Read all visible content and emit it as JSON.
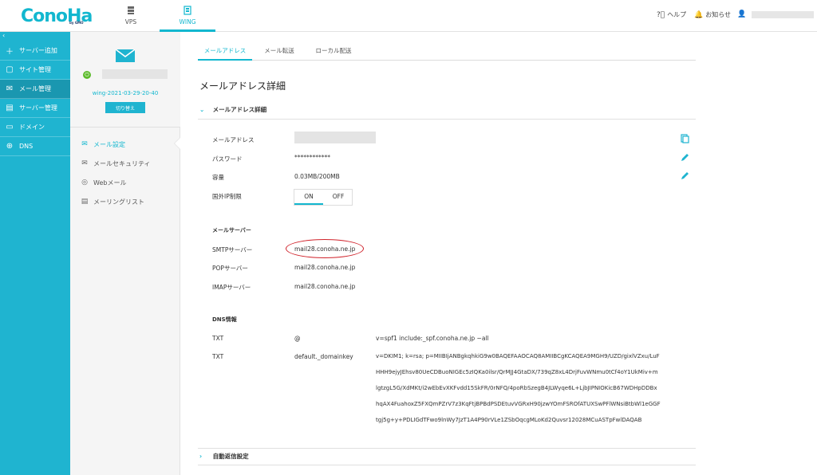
{
  "header": {
    "logo": "ConoHa",
    "logo_sub": "by GMO",
    "nav": [
      {
        "label": "VPS"
      },
      {
        "label": "WING"
      }
    ],
    "help": "ヘルプ",
    "notice": "お知らせ"
  },
  "sidebar": {
    "collapse": "‹",
    "items": [
      {
        "label": "サーバー追加"
      },
      {
        "label": "サイト管理"
      },
      {
        "label": "メール管理"
      },
      {
        "label": "サーバー管理"
      },
      {
        "label": "ドメイン"
      },
      {
        "label": "DNS"
      }
    ]
  },
  "account": {
    "id": "wing-2021-03-29-20-40",
    "switch_label": "切り替え"
  },
  "subnav": [
    {
      "label": "メール設定"
    },
    {
      "label": "メールセキュリティ"
    },
    {
      "label": "Webメール"
    },
    {
      "label": "メーリングリスト"
    }
  ],
  "tabs": [
    {
      "label": "メールアドレス"
    },
    {
      "label": "メール転送"
    },
    {
      "label": "ローカル配送"
    }
  ],
  "main": {
    "title": "メールアドレス詳細",
    "section1": "メールアドレス詳細",
    "rows": {
      "address_label": "メールアドレス",
      "password_label": "パスワード",
      "password_value": "************",
      "capacity_label": "容量",
      "capacity_value": "0.03MB/200MB",
      "foreign_ip_label": "国外IP制限",
      "on": "ON",
      "off": "OFF"
    },
    "mail_server": {
      "title": "メールサーバー",
      "smtp_label": "SMTPサーバー",
      "smtp_value": "mail28.conoha.ne.jp",
      "pop_label": "POPサーバー",
      "pop_value": "mail28.conoha.ne.jp",
      "imap_label": "IMAPサーバー",
      "imap_value": "mail28.conoha.ne.jp"
    },
    "dns": {
      "title": "DNS情報",
      "txt1_label": "TXT",
      "txt1_name": "@",
      "txt1_value": "v=spf1 include:_spf.conoha.ne.jp ~all",
      "txt2_label": "TXT",
      "txt2_name": "default._domainkey",
      "txt2_lines": [
        "v=DKIM1; k=rsa; p=MIIBIjANBgkqhkiG9w0BAQEFAAOCAQ8AMIIBCgKCAQEA9MGH9/UZD/gixlVZxu/LuF",
        "HHH9ejyJEhsv80UeCDBuoNIGEc5zIQKa0ilsr/QrMJJ4GtaDX/739qZ8xL4DrjFuvWNmu0tCf4oY1UkMiv+m",
        "lgtzgL5G/XdMKt/i2wEbEvXKFvdd15SkFR/0rNFQ/4poRbSzegB4JLWyqe6L+LjbJIPNIOKicB67WDHpDDBx",
        "hqAX4FuahoxZ5FXQmPZrV7z3KqFtjBPBdPSDEtuvVGRxH90jzwYOmFSROfATUXSwPFlWNsiBtbWl1eGGF",
        "tgj5g+y+PDLIGdTFwo9lnWy7JzT1A4P90rVLe1ZSbOqcgMLoKd2Quvsr12028MCuASTpFwlDAQAB"
      ]
    },
    "section2": "自動返信設定"
  },
  "colors": {
    "accent": "#12b7cf",
    "sidebar": "#1fb4d0",
    "highlight_circle": "#d0222a",
    "power_green": "#5cbb2b"
  }
}
